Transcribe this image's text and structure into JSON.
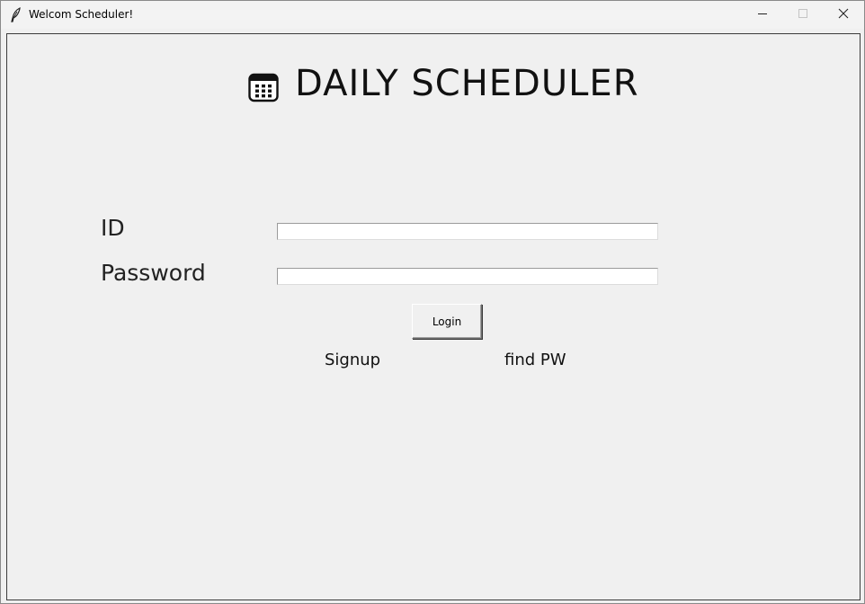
{
  "window": {
    "title": "Welcom Scheduler!",
    "app_icon": "feather-icon",
    "controls": {
      "minimize": "minimize-icon",
      "maximize": "maximize-icon",
      "close": "close-icon"
    }
  },
  "header": {
    "icon": "calendar-icon",
    "title": "DAILY SCHEDULER"
  },
  "form": {
    "id_label": "ID",
    "id_value": "",
    "password_label": "Password",
    "password_value": "",
    "login_label": "Login"
  },
  "links": {
    "signup": "Signup",
    "find_pw": "find PW"
  },
  "colors": {
    "background": "#f0f0f0",
    "entry_background": "#ffffff",
    "text": "#111111"
  }
}
